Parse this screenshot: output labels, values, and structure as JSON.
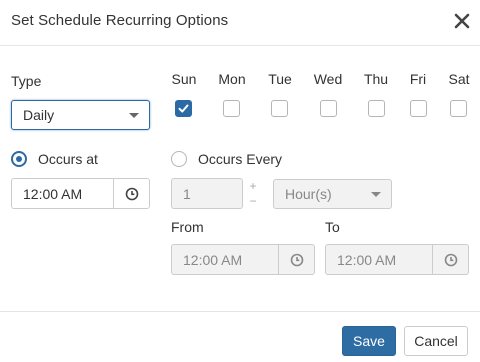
{
  "dialog": {
    "title": "Set Schedule Recurring Options"
  },
  "type": {
    "label": "Type",
    "selected": "Daily"
  },
  "days": [
    {
      "label": "Sun",
      "checked": true
    },
    {
      "label": "Mon",
      "checked": false
    },
    {
      "label": "Tue",
      "checked": false
    },
    {
      "label": "Wed",
      "checked": false
    },
    {
      "label": "Thu",
      "checked": false
    },
    {
      "label": "Fri",
      "checked": false
    },
    {
      "label": "Sat",
      "checked": false
    }
  ],
  "occurs_at": {
    "label": "Occurs at",
    "selected": true,
    "time": "12:00 AM"
  },
  "occurs_every": {
    "label": "Occurs Every",
    "selected": false,
    "count": "1",
    "spin_up": "+",
    "spin_down": "−",
    "unit": "Hour(s)",
    "from_label": "From",
    "from_time": "12:00 AM",
    "to_label": "To",
    "to_time": "12:00 AM"
  },
  "footer": {
    "save_label": "Save",
    "cancel_label": "Cancel"
  },
  "colors": {
    "accent": "#2c6aa6",
    "save_button": "#2e6da4"
  }
}
